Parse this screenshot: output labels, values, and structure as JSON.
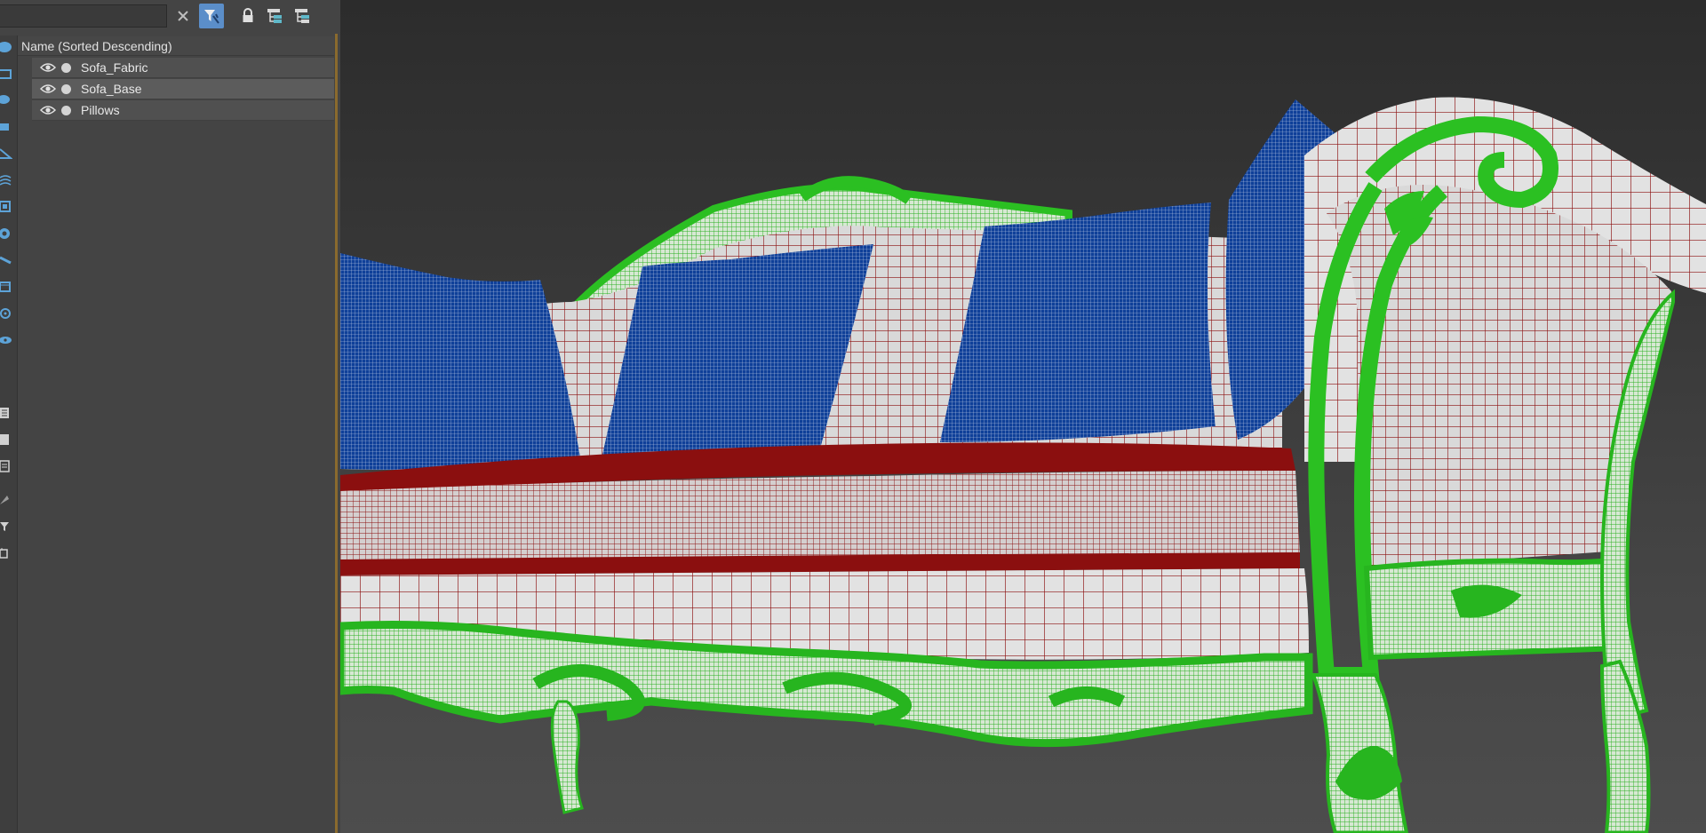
{
  "toolbar": {
    "search_placeholder": "",
    "icons": [
      "close-icon",
      "filter-icon",
      "lock-icon",
      "hierarchy-icon",
      "hierarchy-alt-icon"
    ]
  },
  "explorer": {
    "column_header": "Name (Sorted Descending)",
    "rows": [
      {
        "label": "Sofa_Fabric",
        "selected": false
      },
      {
        "label": "Sofa_Base",
        "selected": true
      },
      {
        "label": "Pillows",
        "selected": false
      }
    ]
  },
  "colors": {
    "accent": "#5b8ec9",
    "panel_bg": "#444444",
    "fabric_wire": "#8b0f0f",
    "base_wire": "#27b51f",
    "pillow_wire": "#0d3f98"
  }
}
